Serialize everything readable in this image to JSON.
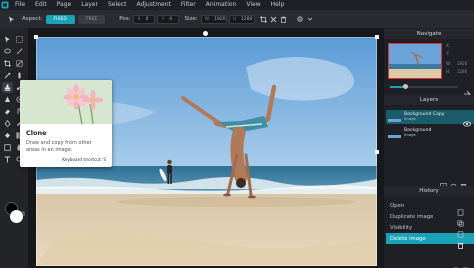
{
  "menu": {
    "items": [
      "File",
      "Edit",
      "Page",
      "Layer",
      "Select",
      "Adjustment",
      "Filter",
      "Animation",
      "View",
      "Help"
    ]
  },
  "options": {
    "aspect_label": "Aspect:",
    "fixed_label": "FIXED",
    "free_label": "FREE",
    "pos_label": "Pos:",
    "pos_x_key": "X",
    "pos_x": "0",
    "pos_y_key": "Y",
    "pos_y": "0",
    "size_label": "Size:",
    "size_w_key": "W",
    "size_w": "1920",
    "size_h_key": "H",
    "size_h": "1280"
  },
  "tooltip": {
    "title": "Clone",
    "description": "Draw and copy from other areas in an image.",
    "shortcut": "Keyboard shortcut: S"
  },
  "navigator": {
    "title": "Navigate",
    "x_label": "X:",
    "y_label": "Y:",
    "w_label": "W:",
    "w_value": "1920",
    "h_label": "H:",
    "h_value": "1280"
  },
  "layers": {
    "title": "Layers",
    "items": [
      {
        "name": "Background Copy",
        "sub": "Image"
      },
      {
        "name": "Background",
        "sub": "Image"
      }
    ]
  },
  "history": {
    "title": "History",
    "items": [
      "Open",
      "Duplicate image",
      "Visibility",
      "Delete image"
    ]
  },
  "colors": {
    "accent": "#1aa3b8",
    "foreground": "#000000",
    "background": "#ffffff"
  }
}
